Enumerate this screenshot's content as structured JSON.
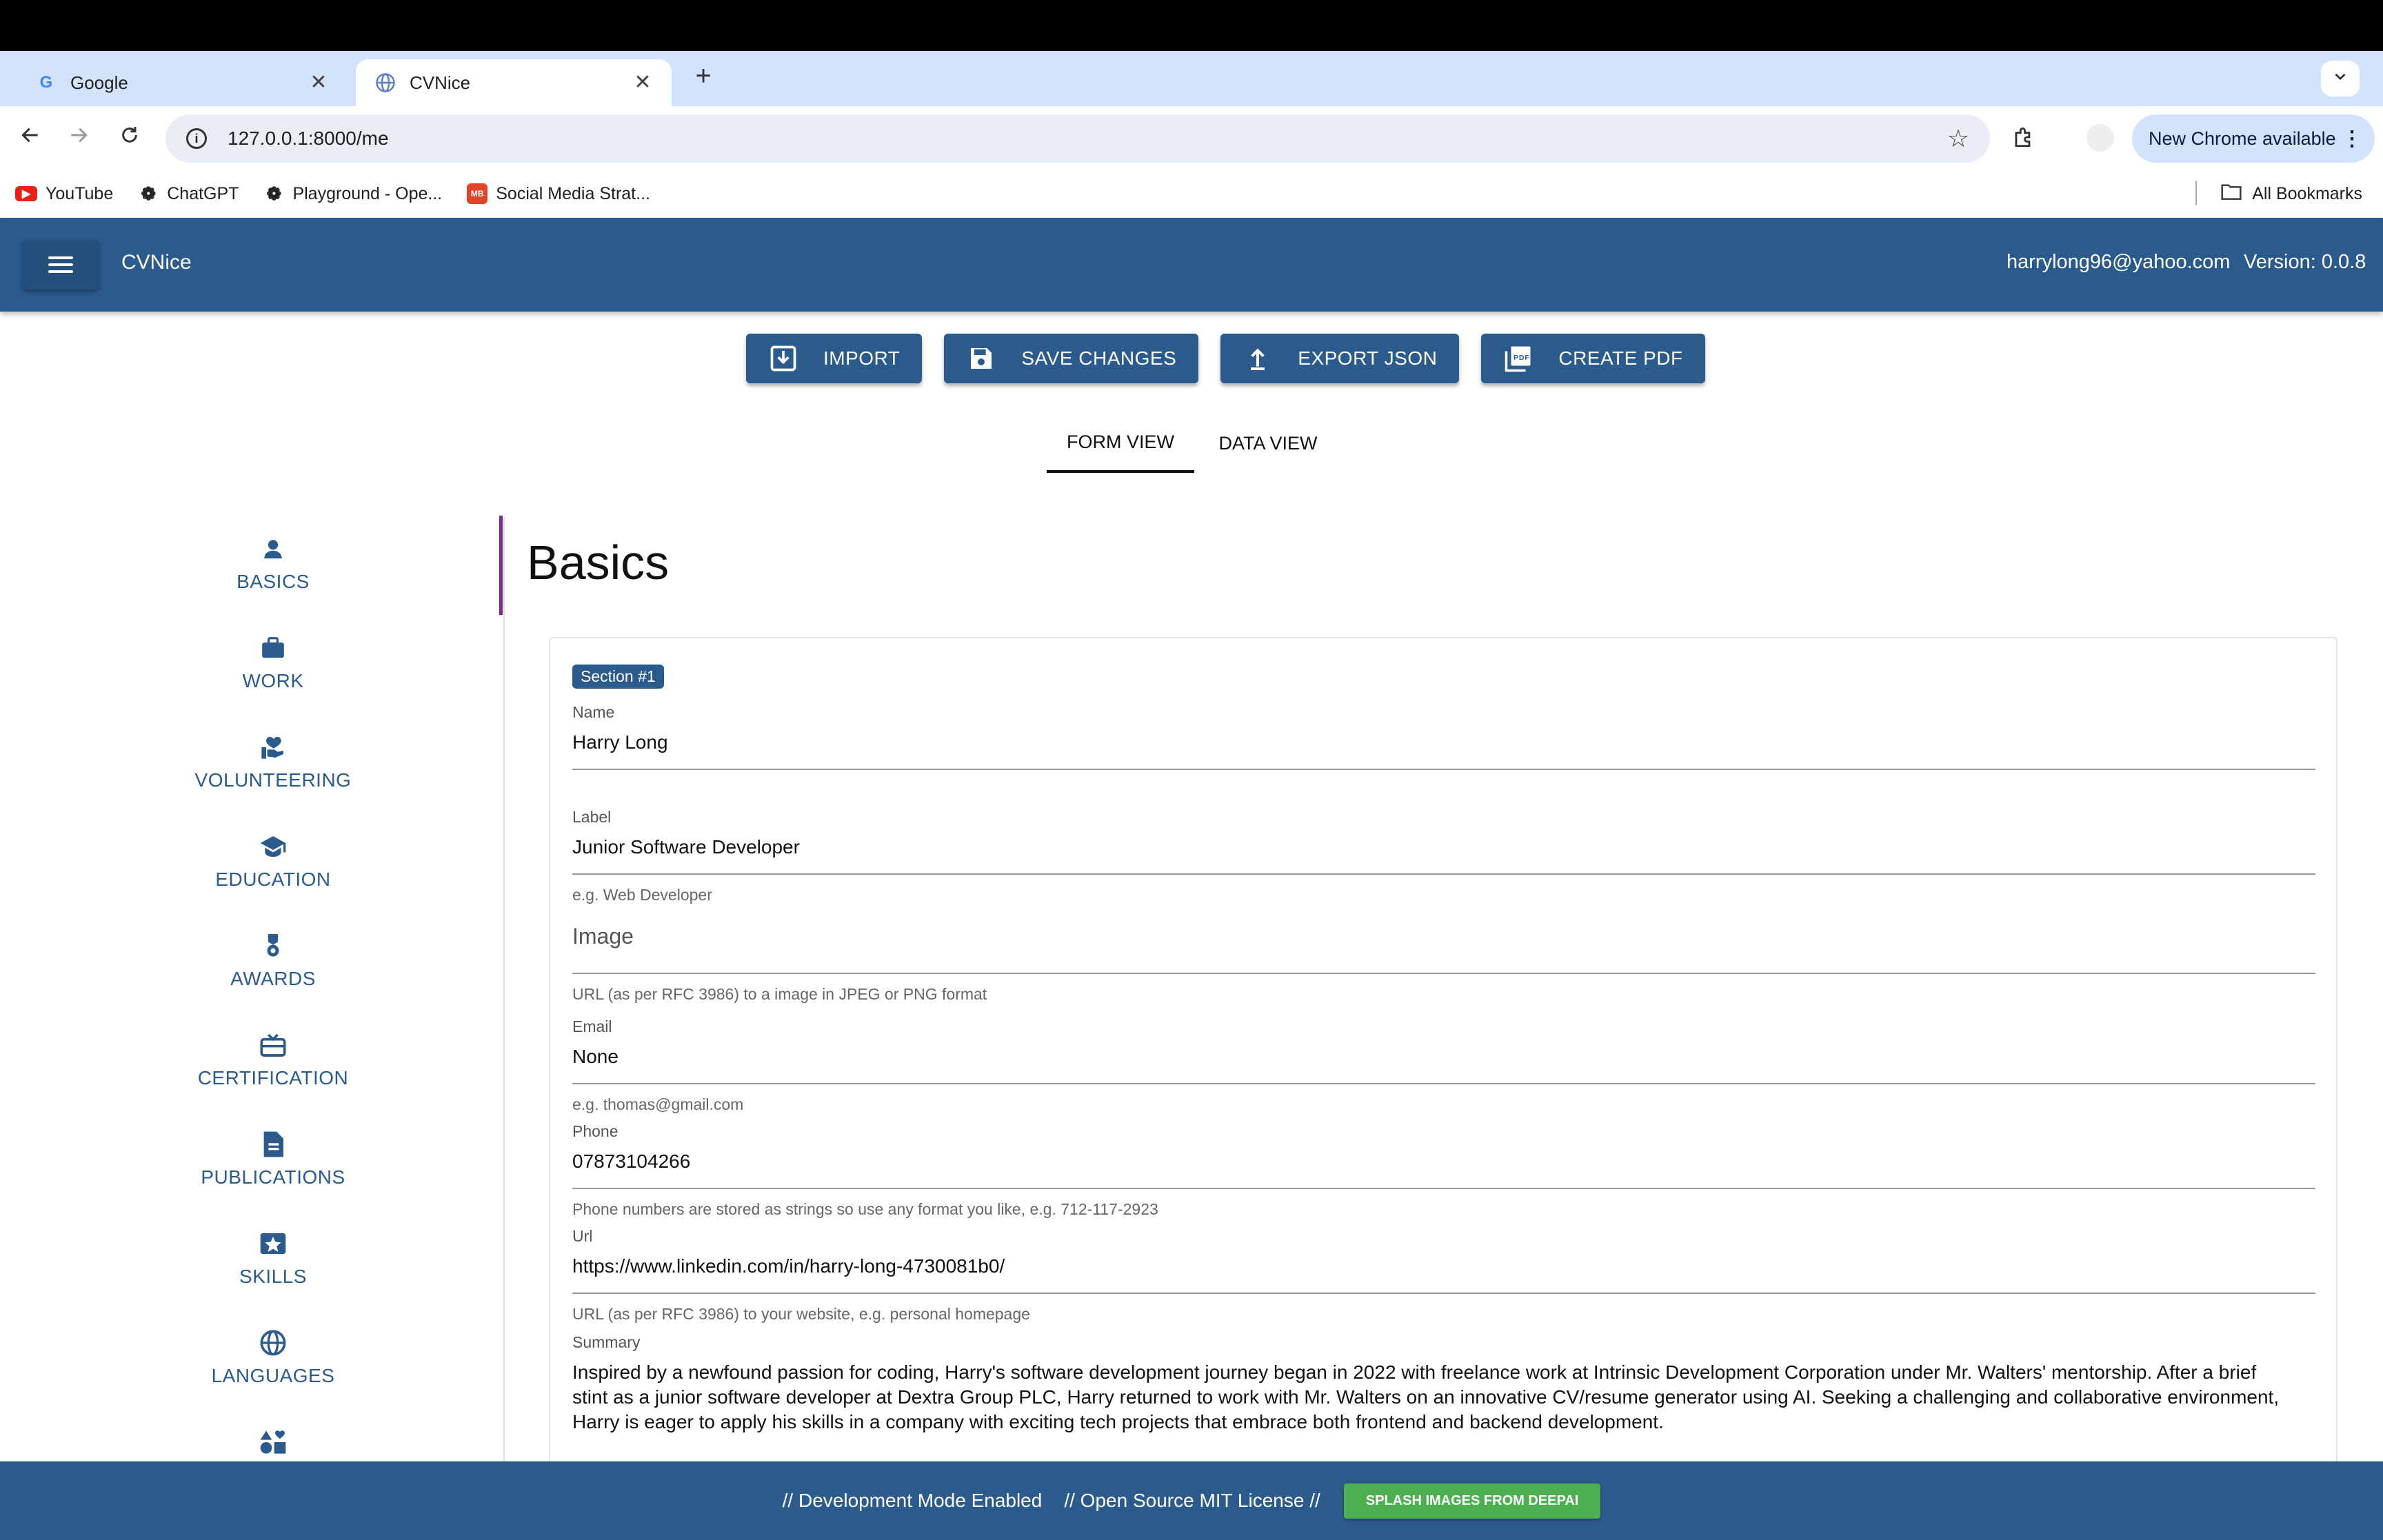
{
  "browser": {
    "tabs": [
      {
        "title": "Google",
        "favicon": "google-icon",
        "active": false
      },
      {
        "title": "CVNice",
        "favicon": "globe-icon",
        "active": true
      }
    ],
    "tab_close_glyph": "✕",
    "new_tab_glyph": "+",
    "url": "127.0.0.1:8000/me",
    "update_chip": "New Chrome available",
    "bookmarks": [
      {
        "label": "YouTube",
        "icon": "youtube-icon"
      },
      {
        "label": "ChatGPT",
        "icon": "openai-icon"
      },
      {
        "label": "Playground - Ope...",
        "icon": "openai-icon"
      },
      {
        "label": "Social Media Strat...",
        "icon": "mb-icon"
      }
    ],
    "all_bookmarks": "All Bookmarks"
  },
  "app": {
    "title": "CVNice",
    "user_email": "harrylong96@yahoo.com",
    "version": "Version: 0.0.8",
    "brand_color": "#2b5a8c"
  },
  "actions": [
    {
      "label": "IMPORT",
      "icon": "import-icon"
    },
    {
      "label": "SAVE CHANGES",
      "icon": "save-icon"
    },
    {
      "label": "EXPORT JSON",
      "icon": "upload-icon"
    },
    {
      "label": "CREATE PDF",
      "icon": "pdf-icon"
    }
  ],
  "view_tabs": [
    {
      "label": "FORM VIEW",
      "active": true
    },
    {
      "label": "DATA VIEW",
      "active": false
    }
  ],
  "sidenav": [
    {
      "label": "BASICS",
      "icon": "person-icon"
    },
    {
      "label": "WORK",
      "icon": "briefcase-icon"
    },
    {
      "label": "VOLUNTEERING",
      "icon": "volunteer-heart-icon"
    },
    {
      "label": "EDUCATION",
      "icon": "graduation-cap-icon"
    },
    {
      "label": "AWARDS",
      "icon": "medal-icon"
    },
    {
      "label": "CERTIFICATION",
      "icon": "certificate-icon"
    },
    {
      "label": "PUBLICATIONS",
      "icon": "document-icon"
    },
    {
      "label": "SKILLS",
      "icon": "star-badge-icon"
    },
    {
      "label": "LANGUAGES",
      "icon": "globe-icon"
    },
    {
      "label": "",
      "icon": "interests-shapes-icon"
    }
  ],
  "section": {
    "title": "Basics",
    "badge": "Section #1",
    "name": {
      "label": "Name",
      "value": "Harry Long"
    },
    "label": {
      "label": "Label",
      "value": "Junior Software Developer",
      "hint": "e.g. Web Developer"
    },
    "image": {
      "placeholder": "Image",
      "hint": "URL (as per RFC 3986) to a image in JPEG or PNG format"
    },
    "email": {
      "label": "Email",
      "value": "None",
      "hint": "e.g. thomas@gmail.com"
    },
    "phone": {
      "label": "Phone",
      "value": "07873104266",
      "hint": "Phone numbers are stored as strings so use any format you like, e.g. 712-117-2923"
    },
    "url": {
      "label": "Url",
      "value": "https://www.linkedin.com/in/harry-long-4730081b0/",
      "hint": "URL (as per RFC 3986) to your website, e.g. personal homepage"
    },
    "summary": {
      "label": "Summary",
      "value": "Inspired by a newfound passion for coding, Harry's software development journey began in 2022 with freelance work at Intrinsic Development Corporation under Mr. Walters' mentorship. After a brief stint as a junior software developer at Dextra Group PLC, Harry returned to work with Mr. Walters on an innovative CV/resume generator using AI. Seeking a challenging and collaborative environment, Harry is eager to apply his skills in a company with exciting tech projects that embrace both frontend and backend development."
    }
  },
  "footer": {
    "dev_mode": "// Development Mode Enabled",
    "license": "// Open Source MIT License //",
    "splash_button": "SPLASH IMAGES FROM DEEPAI"
  }
}
